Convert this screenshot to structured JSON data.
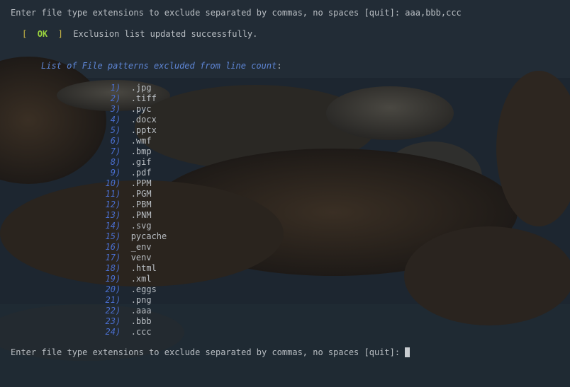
{
  "terminal": {
    "prompt_line_1": {
      "text": "Enter file type extensions to exclude separated by commas, no spaces [quit]: ",
      "input": "aaa,bbb,ccc"
    },
    "status": {
      "bracket_open": "[",
      "ok": "OK",
      "bracket_close": "]",
      "message": "Exclusion list updated successfully."
    },
    "list_heading": {
      "title": "List of File patterns excluded from line count",
      "colon": ":"
    },
    "exclusions": [
      {
        "num": "1",
        "pattern": ".jpg"
      },
      {
        "num": "2",
        "pattern": ".tiff"
      },
      {
        "num": "3",
        "pattern": ".pyc"
      },
      {
        "num": "4",
        "pattern": ".docx"
      },
      {
        "num": "5",
        "pattern": ".pptx"
      },
      {
        "num": "6",
        "pattern": ".wmf"
      },
      {
        "num": "7",
        "pattern": ".bmp"
      },
      {
        "num": "8",
        "pattern": ".gif"
      },
      {
        "num": "9",
        "pattern": ".pdf"
      },
      {
        "num": "10",
        "pattern": ".PPM"
      },
      {
        "num": "11",
        "pattern": ".PGM"
      },
      {
        "num": "12",
        "pattern": ".PBM"
      },
      {
        "num": "13",
        "pattern": ".PNM"
      },
      {
        "num": "14",
        "pattern": ".svg"
      },
      {
        "num": "15",
        "pattern": "pycache"
      },
      {
        "num": "16",
        "pattern": "_env"
      },
      {
        "num": "17",
        "pattern": "venv"
      },
      {
        "num": "18",
        "pattern": ".html"
      },
      {
        "num": "19",
        "pattern": ".xml"
      },
      {
        "num": "20",
        "pattern": ".eggs"
      },
      {
        "num": "21",
        "pattern": ".png"
      },
      {
        "num": "22",
        "pattern": ".aaa"
      },
      {
        "num": "23",
        "pattern": ".bbb"
      },
      {
        "num": "24",
        "pattern": ".ccc"
      }
    ],
    "list_paren": ")",
    "prompt_line_2": {
      "text": "Enter file type extensions to exclude separated by commas, no spaces [quit]: ",
      "input": ""
    }
  },
  "colors": {
    "background": "#1b242c",
    "text": "#b9bec3",
    "ok_green": "#9ad33e",
    "bracket_yellow": "#c9b645",
    "heading_blue": "#5e86d6",
    "number_blue": "#4a6fd0"
  }
}
